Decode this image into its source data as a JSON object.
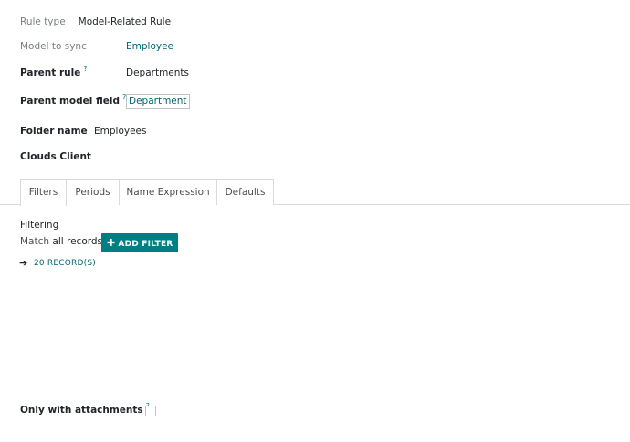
{
  "form": {
    "rule_type": {
      "label": "Rule type",
      "value": "Model-Related Rule"
    },
    "model_to_sync": {
      "label": "Model to sync",
      "value": "Employee"
    },
    "parent_rule": {
      "label": "Parent rule",
      "help": "?",
      "value": "Departments"
    },
    "parent_model_field": {
      "label": "Parent model field",
      "help": "?",
      "value": "Department"
    },
    "folder_name": {
      "label": "Folder name",
      "value": "Employees"
    },
    "clouds_client": {
      "label": "Clouds Client"
    }
  },
  "tabs": [
    {
      "label": "Filters",
      "active": true
    },
    {
      "label": "Periods",
      "active": false
    },
    {
      "label": "Name Expression",
      "active": false
    },
    {
      "label": "Defaults",
      "active": false
    }
  ],
  "filters": {
    "title": "Filtering",
    "match_prefix": "Match",
    "match_value": "all records",
    "add_filter_label": "ADD FILTER",
    "add_filter_icon": "plus-icon",
    "records_label": "20 RECORD(S)",
    "records_icon": "arrow-right-icon"
  },
  "attachments": {
    "label": "Only with attachments",
    "help": "?",
    "checked": false
  },
  "colors": {
    "accent": "#017e84",
    "link": "#01666b",
    "muted": "#7b7f84",
    "border": "#d8dadd"
  }
}
